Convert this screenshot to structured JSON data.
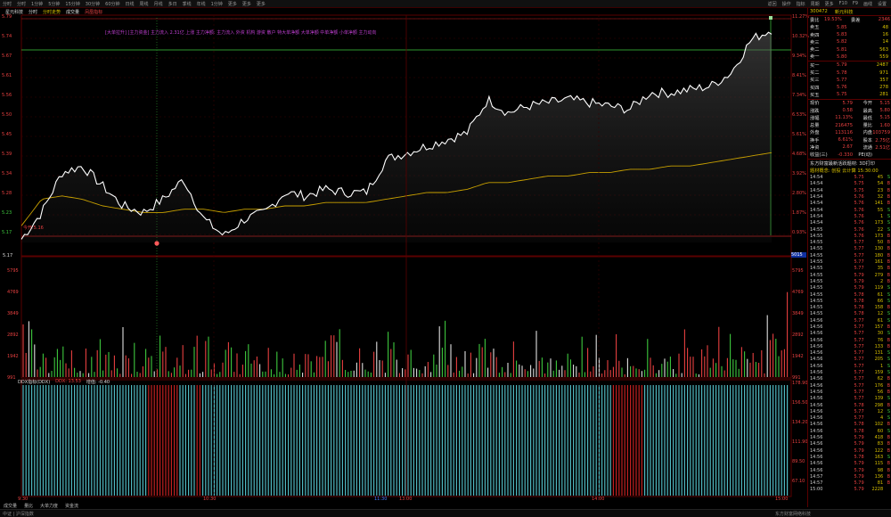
{
  "toolbar": {
    "left_items": [
      "分时",
      "分时",
      "1分钟",
      "5分钟",
      "15分钟",
      "30分钟",
      "60分钟",
      "日线",
      "周线",
      "月线",
      "多日",
      "季线",
      "年线",
      "1分钟",
      "更多",
      "更多",
      "更多"
    ],
    "right_items": [
      "返回",
      "操作",
      "指标",
      "周期",
      "更多",
      "F10",
      "F9",
      "画线",
      "设置"
    ]
  },
  "header": {
    "code_name": "星元科技",
    "period": "分时",
    "mode": "分时走势",
    "indicator": "成交量",
    "extra": "凤凰指标"
  },
  "annotation": {
    "text": "[大单拉升]   [主力资金]  主力流入 2.31亿   上涨  主力净额:    主力流入    外资   机构   游资   散户    特大单净额   大单净额   中单净额   小单净额   主力动向"
  },
  "price_axis": {
    "left_labels": [
      "5.79",
      "5.74",
      "5.67",
      "5.61",
      "5.56",
      "5.50",
      "5.45",
      "5.39",
      "5.34",
      "5.28",
      "5.23",
      "5.17"
    ],
    "right_labels": [
      "11.27%",
      "10.32%",
      "9.34%",
      "8.41%",
      "7.34%",
      "6.53%",
      "5.61%",
      "4.68%",
      "3.92%",
      "2.80%",
      "1.87%",
      "0.93%"
    ],
    "open_label": "今开:5.16",
    "current_price_tag": "5.17",
    "right_current_tag": "5015"
  },
  "volume_axis": {
    "labels": [
      "5795",
      "4769",
      "3849",
      "2892",
      "1942",
      "991"
    ]
  },
  "indicator_panel": {
    "title": "DDX指标(DDX)",
    "value_label": "DDX: 13.53",
    "extra_label": "增值: -0.40",
    "right_labels": [
      "178.90",
      "156.50",
      "134.20",
      "111.90",
      "89.50",
      "67.10"
    ]
  },
  "time_axis": {
    "labels": [
      "9:30",
      "10:30",
      "11:30",
      "13:00",
      "14:00",
      "15:00"
    ]
  },
  "right_panel": {
    "code": "300472",
    "name": "新元科技",
    "ratio_label": "委比",
    "ratio_value": "19.53%",
    "diff_label": "委差",
    "diff_value": "2346",
    "sell_orders": [
      {
        "label": "卖五",
        "price": "5.85",
        "vol": "48"
      },
      {
        "label": "卖四",
        "price": "5.83",
        "vol": "16"
      },
      {
        "label": "卖三",
        "price": "5.82",
        "vol": "14"
      },
      {
        "label": "卖二",
        "price": "5.81",
        "vol": "563"
      },
      {
        "label": "卖一",
        "price": "5.80",
        "vol": "559"
      }
    ],
    "buy_orders": [
      {
        "label": "买一",
        "price": "5.79",
        "vol": "2487"
      },
      {
        "label": "买二",
        "price": "5.78",
        "vol": "971"
      },
      {
        "label": "买三",
        "price": "5.77",
        "vol": "357"
      },
      {
        "label": "买四",
        "price": "5.76",
        "vol": "278"
      },
      {
        "label": "买五",
        "price": "5.75",
        "vol": "281"
      }
    ],
    "stats": [
      {
        "l1": "现价",
        "v1": "5.79",
        "l2": "今开",
        "v2": "5.15"
      },
      {
        "l1": "涨跌",
        "v1": "0.58",
        "l2": "最高",
        "v2": "5.80"
      },
      {
        "l1": "涨幅",
        "v1": "11.13%",
        "l2": "最低",
        "v2": "5.15"
      },
      {
        "l1": "总量",
        "v1": "216475",
        "l2": "量比",
        "v2": "1.60"
      },
      {
        "l1": "外盘",
        "v1": "113116",
        "l2": "内盘",
        "v2": "103759"
      },
      {
        "l1": "换手",
        "v1": "6.61%",
        "l2": "股本",
        "v2": "2.75亿"
      },
      {
        "l1": "净资",
        "v1": "2.67",
        "l2": "流通",
        "v2": "2.51亿"
      },
      {
        "l1": "收益(三)",
        "v1": "-0.330",
        "l2": "PE(动)",
        "v2": ""
      }
    ],
    "notice1": "东方财富最新活跃题材:  3D打印",
    "notice2": "题材概念: 创投  云计算  15:30:00",
    "trades": [
      {
        "t": "14:54",
        "p": "5.75",
        "v": "45",
        "d": "S"
      },
      {
        "t": "14:54",
        "p": "5.75",
        "v": "54",
        "d": "B"
      },
      {
        "t": "14:54",
        "p": "5.75",
        "v": "23",
        "d": "B"
      },
      {
        "t": "14:54",
        "p": "5.76",
        "v": "32",
        "d": "B"
      },
      {
        "t": "14:54",
        "p": "5.76",
        "v": "141",
        "d": "B"
      },
      {
        "t": "14:54",
        "p": "5.76",
        "v": "55",
        "d": "S"
      },
      {
        "t": "14:54",
        "p": "5.76",
        "v": "1",
        "d": "S"
      },
      {
        "t": "14:54",
        "p": "5.76",
        "v": "173",
        "d": "S"
      },
      {
        "t": "14:55",
        "p": "5.76",
        "v": "22",
        "d": "S"
      },
      {
        "t": "14:55",
        "p": "5.76",
        "v": "173",
        "d": "B"
      },
      {
        "t": "14:55",
        "p": "5.77",
        "v": "50",
        "d": "B"
      },
      {
        "t": "14:55",
        "p": "5.77",
        "v": "130",
        "d": "B"
      },
      {
        "t": "14:55",
        "p": "5.77",
        "v": "180",
        "d": "B"
      },
      {
        "t": "14:55",
        "p": "5.77",
        "v": "161",
        "d": "B"
      },
      {
        "t": "14:55",
        "p": "5.77",
        "v": "35",
        "d": "B"
      },
      {
        "t": "14:55",
        "p": "5.79",
        "v": "279",
        "d": "B"
      },
      {
        "t": "14:55",
        "p": "5.79",
        "v": "2",
        "d": "B"
      },
      {
        "t": "14:55",
        "p": "5.79",
        "v": "119",
        "d": "S"
      },
      {
        "t": "14:55",
        "p": "5.78",
        "v": "61",
        "d": "S"
      },
      {
        "t": "14:55",
        "p": "5.78",
        "v": "66",
        "d": "S"
      },
      {
        "t": "14:55",
        "p": "5.78",
        "v": "158",
        "d": "B"
      },
      {
        "t": "14:55",
        "p": "5.78",
        "v": "12",
        "d": "S"
      },
      {
        "t": "14:56",
        "p": "5.77",
        "v": "61",
        "d": "S"
      },
      {
        "t": "14:56",
        "p": "5.77",
        "v": "157",
        "d": "B"
      },
      {
        "t": "14:56",
        "p": "5.77",
        "v": "30",
        "d": "S"
      },
      {
        "t": "14:56",
        "p": "5.77",
        "v": "76",
        "d": "B"
      },
      {
        "t": "14:56",
        "p": "5.77",
        "v": "133",
        "d": "B"
      },
      {
        "t": "14:56",
        "p": "5.77",
        "v": "131",
        "d": "S"
      },
      {
        "t": "14:56",
        "p": "5.77",
        "v": "205",
        "d": "S"
      },
      {
        "t": "14:56",
        "p": "5.77",
        "v": "1",
        "d": "S"
      },
      {
        "t": "14:56",
        "p": "5.77",
        "v": "159",
        "d": "S"
      },
      {
        "t": "14:56",
        "p": "5.77",
        "v": "62",
        "d": "B"
      },
      {
        "t": "14:56",
        "p": "5.77",
        "v": "176",
        "d": "B"
      },
      {
        "t": "14:56",
        "p": "5.77",
        "v": "56",
        "d": "B"
      },
      {
        "t": "14:56",
        "p": "5.77",
        "v": "139",
        "d": "S"
      },
      {
        "t": "14:56",
        "p": "5.78",
        "v": "298",
        "d": "B"
      },
      {
        "t": "14:56",
        "p": "5.77",
        "v": "12",
        "d": "S"
      },
      {
        "t": "14:56",
        "p": "5.77",
        "v": "4",
        "d": "S"
      },
      {
        "t": "14:56",
        "p": "5.78",
        "v": "102",
        "d": "B"
      },
      {
        "t": "14:56",
        "p": "5.78",
        "v": "60",
        "d": "S"
      },
      {
        "t": "14:56",
        "p": "5.79",
        "v": "418",
        "d": "B"
      },
      {
        "t": "14:56",
        "p": "5.79",
        "v": "83",
        "d": "B"
      },
      {
        "t": "14:56",
        "p": "5.79",
        "v": "122",
        "d": "B"
      },
      {
        "t": "14:56",
        "p": "5.78",
        "v": "163",
        "d": "S"
      },
      {
        "t": "14:56",
        "p": "5.79",
        "v": "115",
        "d": "B"
      },
      {
        "t": "14:56",
        "p": "5.79",
        "v": "98",
        "d": "B"
      },
      {
        "t": "14:57",
        "p": "5.79",
        "v": "136",
        "d": "B"
      },
      {
        "t": "14:57",
        "p": "5.79",
        "v": "81",
        "d": "B"
      },
      {
        "t": "15:00",
        "p": "5.79",
        "v": "2228",
        "d": ""
      }
    ]
  },
  "bottom_tabs": [
    "成交量",
    "量比",
    "大单力度",
    "资金流"
  ],
  "status": {
    "left": "中证 | 沪深指数",
    "right": "东方财富网络科技"
  },
  "colors": {
    "up": "#e84040",
    "down": "#3ec83e",
    "price_line": "#ffffff",
    "avg_line": "#c8a000",
    "frame": "#5a0000",
    "cyan_bar": "#4fb8c0",
    "red_bar": "#c02020",
    "annotation": "#c03fd0"
  },
  "chart_data": {
    "type": "line",
    "title": "",
    "series": [
      {
        "values": [
          5.16,
          5.24,
          5.36,
          5.38,
          5.32,
          5.26,
          5.24,
          5.28,
          5.34,
          5.22,
          5.17,
          5.22,
          5.24,
          5.3,
          5.29,
          5.31,
          5.3,
          5.3,
          5.4,
          5.42,
          5.44,
          5.46,
          5.48,
          5.58,
          5.54,
          5.56,
          5.57,
          5.58,
          5.57,
          5.56,
          5.55,
          5.6,
          5.6,
          5.61,
          5.62,
          5.66,
          5.76,
          5.79
        ]
      },
      {
        "values": [
          5.2,
          5.28,
          5.29,
          5.28,
          5.26,
          5.25,
          5.24,
          5.24,
          5.25,
          5.25,
          5.24,
          5.25,
          5.25,
          5.26,
          5.26,
          5.27,
          5.27,
          5.27,
          5.28,
          5.29,
          5.3,
          5.3,
          5.31,
          5.33,
          5.33,
          5.34,
          5.35,
          5.35,
          5.36,
          5.36,
          5.37,
          5.37,
          5.38,
          5.38,
          5.39,
          5.4,
          5.41,
          5.42
        ]
      }
    ],
    "ylim": [
      5.15,
      5.82
    ]
  }
}
